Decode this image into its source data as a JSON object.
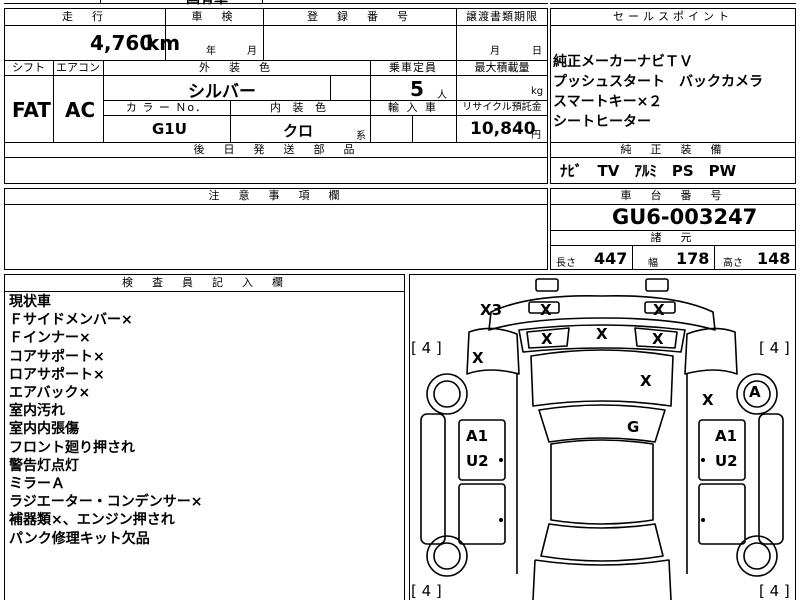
{
  "top_strip": {
    "partial_text": "国有車"
  },
  "spec": {
    "mileage_header": "走　行",
    "mileage_value": "4,760",
    "mileage_unit": "km",
    "inspection_header": "車　検",
    "inspection_year": "年",
    "inspection_month": "月",
    "registration_header": "登　録　番　号",
    "transfer_header": "譲渡書類期限",
    "transfer_month": "月",
    "transfer_day": "日",
    "shift_header": "シフト",
    "aircon_header": "エアコン",
    "exterior_color_header": "外　装　色",
    "capacity_header": "乗車定員",
    "max_load_header": "最大積載量",
    "shift_value": "FAT",
    "aircon_value": "AC",
    "exterior_color_value": "シルバー",
    "capacity_value": "5",
    "capacity_unit": "人",
    "max_load_unit": "kg",
    "color_no_header": "カ ラ ー Ｎo．",
    "interior_color_header": "内 装 色",
    "import_header": "輸 入 車",
    "recycle_header": "リサイクル預託金",
    "color_no_value": "G1U",
    "interior_color_value": "クロ",
    "interior_color_suffix": "系",
    "recycle_value": "10,840",
    "recycle_unit": "円",
    "parts_header": "後　日　発　送　部　品"
  },
  "sales_points": {
    "header": "セールスポイント",
    "lines": [
      "純正メーカーナビＴＶ",
      "プッシュスタート　バックカメラ",
      "スマートキー×２",
      "シートヒーター"
    ]
  },
  "factory_equipment": {
    "header": "純　正　装　備",
    "value": "ﾅﾋﾞ　TV　ｱﾙﾐ　PS　PW"
  },
  "caution": {
    "header": "注　意　事　項　欄"
  },
  "chassis": {
    "header": "車　台　番　号",
    "value": "GU6-003247"
  },
  "dimensions": {
    "header": "諸　元",
    "length_label": "長さ",
    "length_value": "447",
    "width_label": "幅",
    "width_value": "178",
    "height_label": "高さ",
    "height_value": "148"
  },
  "inspector": {
    "header": "検　査　員　記　入　欄",
    "lines": [
      "現状車",
      "Ｆサイドメンバー×",
      "Ｆインナー×",
      "コアサポート×",
      "ロアサポート×",
      "エアバック×",
      "室内汚れ",
      "室内内張傷",
      "フロント廻り押され",
      "警告灯点灯",
      "ミラーＡ",
      "ラジエーター・コンデンサー×",
      "補器類×、エンジン押され",
      "パンク修理キット欠品"
    ]
  },
  "diagram": {
    "tire_tl": "[ 4 ]",
    "tire_tr": "[ 4 ]",
    "tire_bl": "[ 4 ]",
    "tire_br": "[ 4 ]",
    "marks": {
      "x3": "X3",
      "top_left": "X",
      "top_right": "X",
      "row2_left": "X",
      "row2_mid": "X",
      "row2_right": "X",
      "left_fender": "X",
      "hood": "X",
      "right_side": "X",
      "right_wheel": "A",
      "roof": "G",
      "left_door_1": "A1",
      "left_door_2": "U2",
      "right_door_1": "A1",
      "right_door_2": "U2"
    }
  }
}
